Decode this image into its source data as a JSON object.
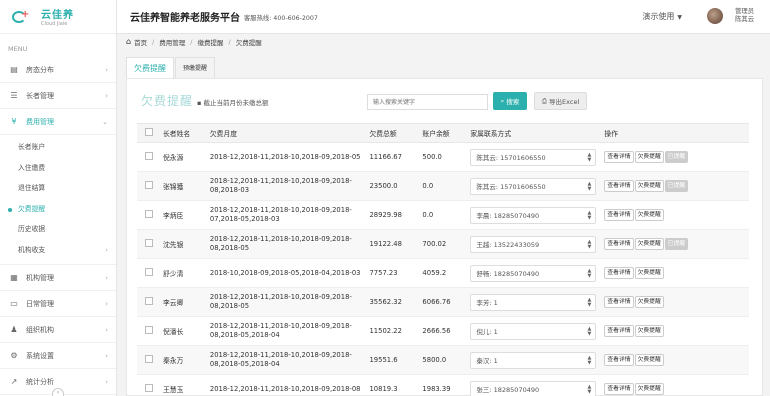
{
  "app": {
    "logo_name": "云佳养",
    "logo_sub": "Cloud Jiaie",
    "title": "云佳养智能养老服务平台",
    "hotline": "客服热线: 400-606-2007",
    "demo_label": "演示使用",
    "user_role": "管理员",
    "user_name": "陈其云"
  },
  "sidebar": {
    "menu_title": "MENU",
    "items": [
      {
        "label": "房态分布",
        "icon": "building-icon"
      },
      {
        "label": "长者管理",
        "icon": "elder-icon"
      },
      {
        "label": "费用管理",
        "icon": "yen-icon"
      }
    ],
    "sub_items": [
      "长者账户",
      "入住缴费",
      "退住结算",
      "欠费提醒",
      "历史收据",
      "机构收支"
    ],
    "items_after": [
      {
        "label": "机构管理",
        "icon": "institution-icon"
      },
      {
        "label": "日常管理",
        "icon": "calendar-icon"
      },
      {
        "label": "组织机构",
        "icon": "group-icon"
      },
      {
        "label": "系统设置",
        "icon": "gear-icon"
      },
      {
        "label": "统计分析",
        "icon": "chart-icon"
      }
    ]
  },
  "breadcrumb": [
    "首页",
    "费用管理",
    "缴费提醒",
    "欠费提醒"
  ],
  "tabs": [
    "欠费提醒",
    "预缴提醒"
  ],
  "page": {
    "heading": "欠费提醒",
    "description": "截止当前月份未缴总额",
    "search_placeholder": "输入搜索关键字",
    "search_label": "搜索",
    "export_label": "导出Excel"
  },
  "table": {
    "columns": [
      "",
      "长者姓名",
      "欠费月度",
      "欠费总额",
      "账户余额",
      "家属联系方式",
      "操作"
    ],
    "actions": {
      "detail": "查看详情",
      "remind": "欠费提醒",
      "reminded": "已提醒"
    },
    "rows": [
      {
        "name": "倪永源",
        "months": "2018-12,2018-11,2018-10,2018-09,2018-05",
        "total": "11166.67",
        "balance": "500.0",
        "contact": "陈其云:  15701606550",
        "reminded": true
      },
      {
        "name": "张锦獲",
        "months": "2018-12,2018-11,2018-10,2018-09,2018-08,2018-03",
        "total": "23500.0",
        "balance": "0.0",
        "contact": "陈其云:  15701606550",
        "reminded": true
      },
      {
        "name": "李炳臣",
        "months": "2018-12,2018-11,2018-10,2018-09,2018-07,2018-05,2018-03",
        "total": "28929.98",
        "balance": "0.0",
        "contact": "李晨:  18285070490",
        "reminded": false
      },
      {
        "name": "沈先银",
        "months": "2018-12,2018-11,2018-10,2018-09,2018-08,2018-05",
        "total": "19122.48",
        "balance": "700.02",
        "contact": "王越:  13522433059",
        "reminded": true
      },
      {
        "name": "舒少清",
        "months": "2018-10,2018-09,2018-05,2018-04,2018-03",
        "total": "7757.23",
        "balance": "4059.2",
        "contact": "舒畅:  18285070490",
        "reminded": false
      },
      {
        "name": "李云卿",
        "months": "2018-12,2018-11,2018-10,2018-09,2018-08,2018-05",
        "total": "35562.32",
        "balance": "6066.76",
        "contact": "李芳:  1",
        "reminded": false
      },
      {
        "name": "倪潘长",
        "months": "2018-12,2018-11,2018-10,2018-09,2018-08,2018-05,2018-04",
        "total": "11502.22",
        "balance": "2666.56",
        "contact": "倪儿:  1",
        "reminded": false
      },
      {
        "name": "秦永万",
        "months": "2018-12,2018-11,2018-10,2018-09,2018-08,2018-05,2018-04",
        "total": "19551.6",
        "balance": "5800.0",
        "contact": "秦汉:  1",
        "reminded": false
      },
      {
        "name": "王慧玉",
        "months": "2018-12,2018-11,2018-10,2018-09,2018-08",
        "total": "10819.3",
        "balance": "1983.39",
        "contact": "张三:  18285070490",
        "reminded": false
      }
    ]
  }
}
